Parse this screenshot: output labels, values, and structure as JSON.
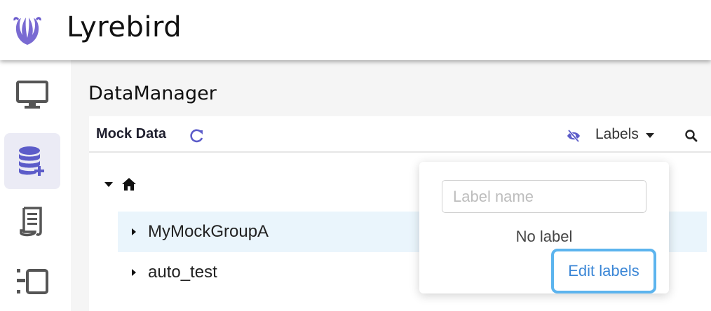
{
  "app": {
    "title": "Lyrebird",
    "logo_icon": "lyrebird-logo-icon",
    "accent_color": "#5c5cc9"
  },
  "sidebar": {
    "items": [
      {
        "icon": "monitor-icon",
        "active": false
      },
      {
        "icon": "database-add-icon",
        "active": true
      },
      {
        "icon": "scroll-icon",
        "active": false
      },
      {
        "icon": "layout-panel-icon",
        "active": false
      }
    ]
  },
  "page": {
    "title": "DataManager"
  },
  "panel": {
    "title": "Mock Data",
    "refresh_icon": "refresh-icon",
    "hide_icon": "eye-off-icon",
    "labels_dropdown": "Labels",
    "search_icon": "search-icon"
  },
  "tree": {
    "root_icon": "home-icon",
    "items": [
      {
        "label": "MyMockGroupA",
        "highlighted": true
      },
      {
        "label": "auto_test",
        "highlighted": false
      }
    ]
  },
  "label_popover": {
    "input_placeholder": "Label name",
    "input_value": "",
    "empty_text": "No label",
    "edit_button": "Edit labels",
    "edit_button_border_color": "#5cb4ee",
    "edit_text_color": "#3a86d6"
  }
}
